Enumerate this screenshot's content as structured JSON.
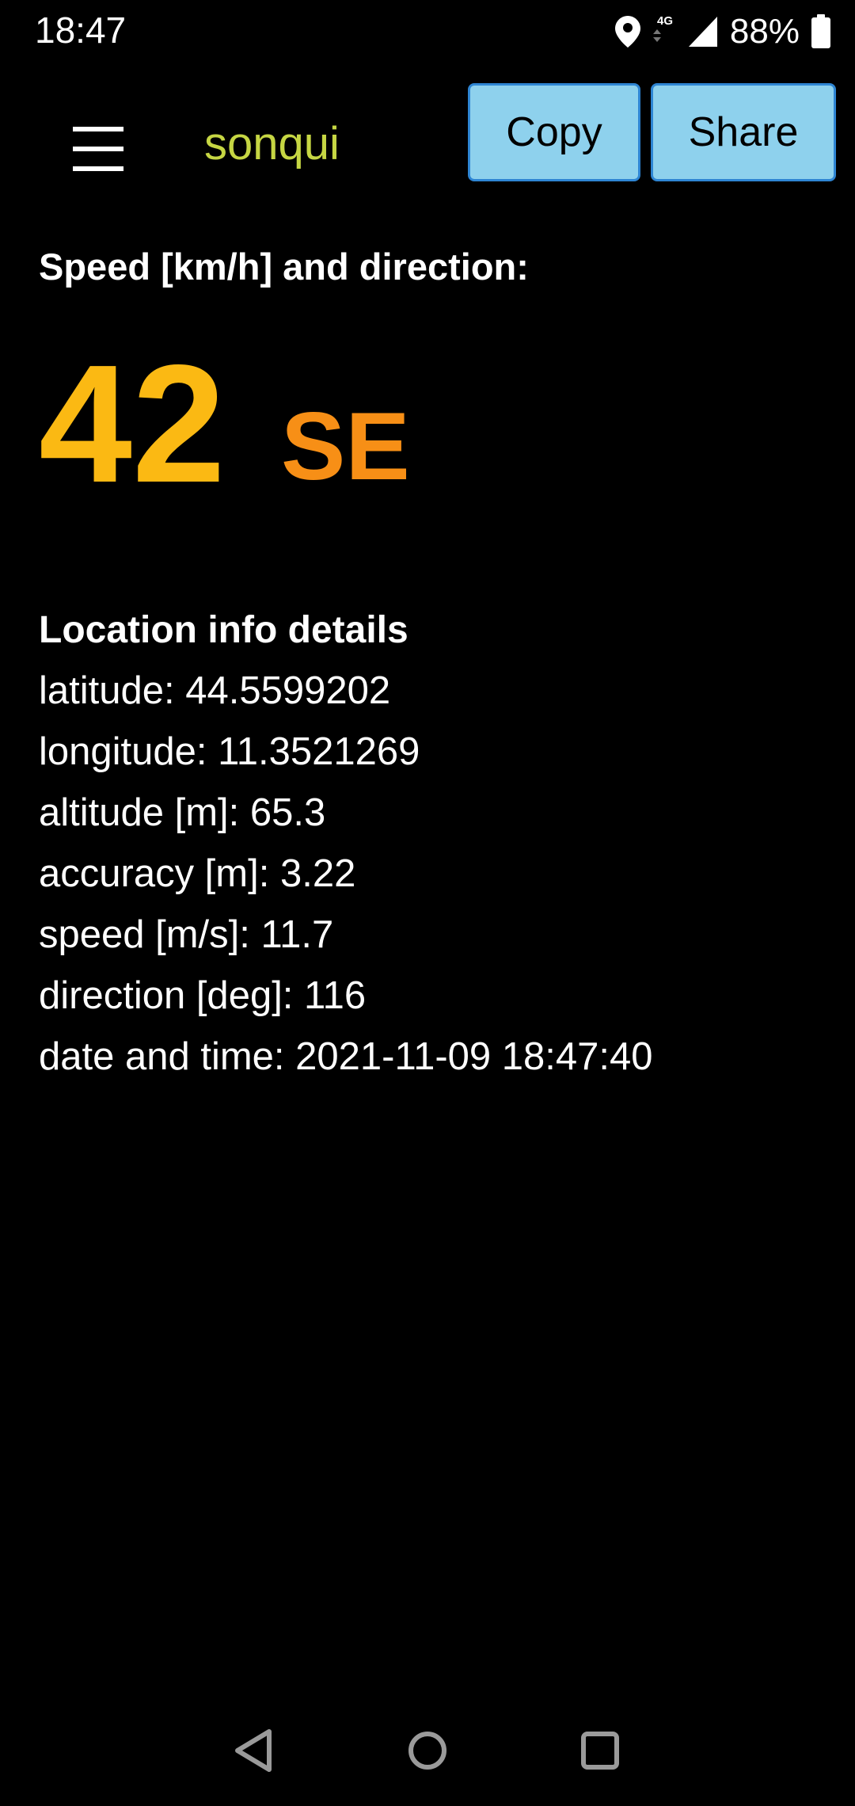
{
  "status_bar": {
    "time": "18:47",
    "network": "4G",
    "battery": "88%",
    "icons": [
      "location-icon",
      "network-4g-icon",
      "signal-icon",
      "battery-icon"
    ]
  },
  "app_bar": {
    "title": "sonqui",
    "menu_icon": "hamburger-menu-icon",
    "copy_label": "Copy",
    "share_label": "Share"
  },
  "speed": {
    "heading": "Speed [km/h] and direction:",
    "value": "42",
    "direction": "SE"
  },
  "details": {
    "heading": "Location info details",
    "lines": [
      "latitude: 44.5599202",
      "longitude: 11.3521269",
      "altitude [m]: 65.3",
      "accuracy [m]: 3.22",
      "speed [m/s]: 11.7",
      "direction [deg]: 116",
      "date and time: 2021-11-09 18:47:40"
    ]
  },
  "nav_bar": {
    "icons": [
      "back-icon",
      "home-icon",
      "recents-icon"
    ]
  },
  "colors": {
    "background": "#000000",
    "title": "#c6d643",
    "speed_value": "#fbb913",
    "speed_direction": "#f78f16",
    "button_fill": "#8ed1ed",
    "button_border": "#2e85d3",
    "text": "#ffffff"
  }
}
